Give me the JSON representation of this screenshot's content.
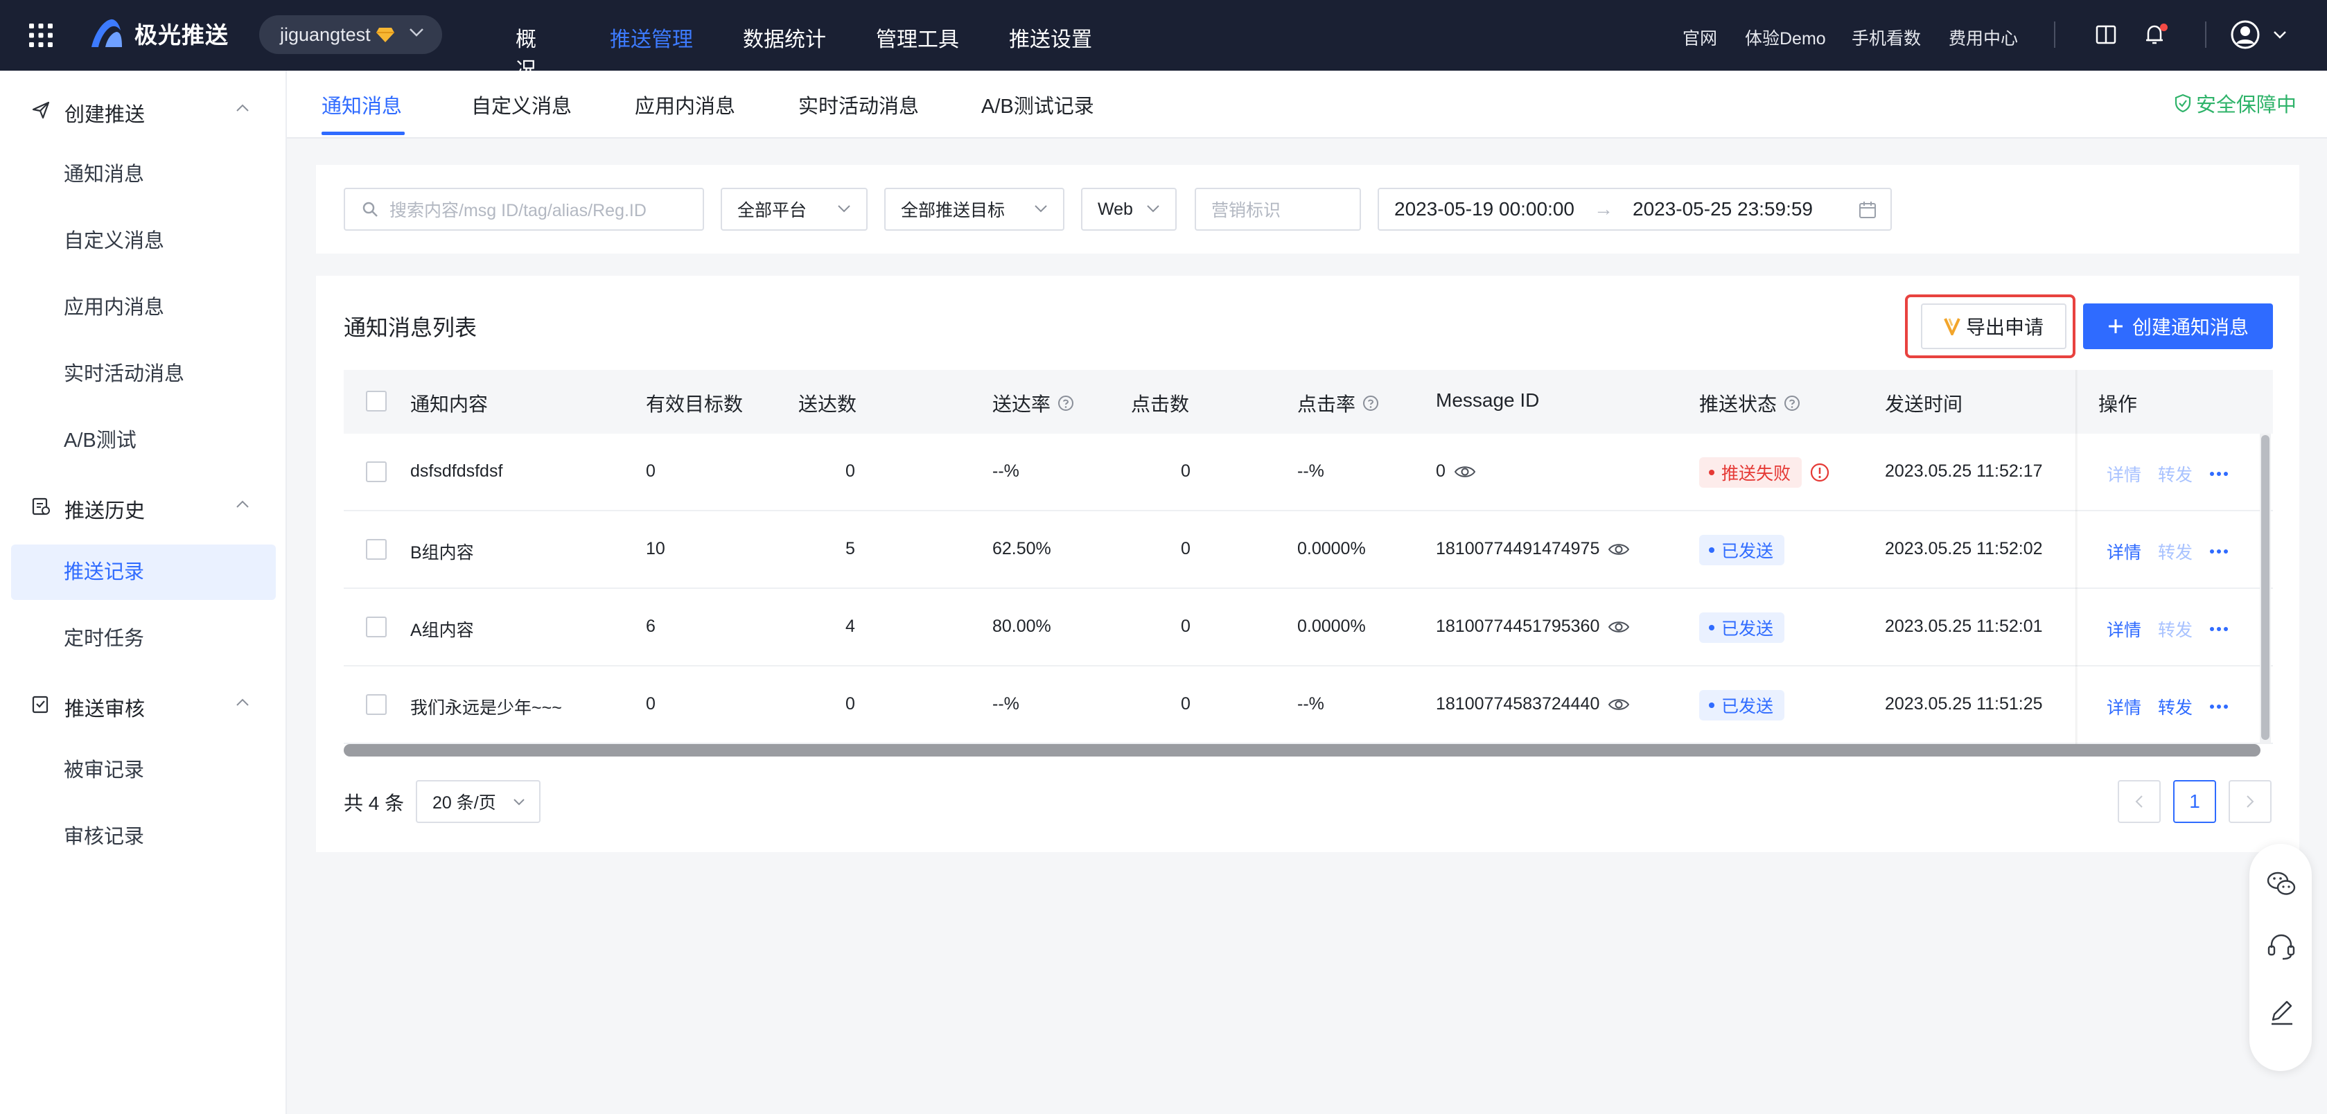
{
  "topbar": {
    "brand": "极光推送",
    "account": "jiguangtest",
    "nav": [
      "概况",
      "推送管理",
      "数据统计",
      "管理工具",
      "推送设置"
    ],
    "active_nav": "推送管理",
    "links": [
      "官网",
      "体验Demo",
      "手机看数",
      "费用中心"
    ],
    "icons": [
      "apps-grid-icon",
      "book-icon",
      "bell-icon",
      "user-avatar-icon"
    ]
  },
  "sidebar": {
    "groups": [
      {
        "label": "创建推送",
        "items": [
          "通知消息",
          "自定义消息",
          "应用内消息",
          "实时活动消息",
          "A/B测试"
        ]
      },
      {
        "label": "推送历史",
        "items": [
          "推送记录",
          "定时任务"
        ]
      },
      {
        "label": "推送审核",
        "items": [
          "被审记录",
          "审核记录"
        ]
      }
    ],
    "active_item": "推送记录"
  },
  "tabs": {
    "items": [
      "通知消息",
      "自定义消息",
      "应用内消息",
      "实时活动消息",
      "A/B测试记录"
    ],
    "active": "通知消息",
    "security": "安全保障中"
  },
  "filters": {
    "search_placeholder": "搜索内容/msg ID/tag/alias/Reg.ID",
    "platform": "全部平台",
    "target": "全部推送目标",
    "channel": "Web",
    "marketing_placeholder": "营销标识",
    "date_start": "2023-05-19 00:00:00",
    "date_arrow": "→",
    "date_end": "2023-05-25 23:59:59"
  },
  "list": {
    "title": "通知消息列表",
    "export_label": "导出申请",
    "create_label": "创建通知消息",
    "columns": [
      "通知内容",
      "有效目标数",
      "送达数",
      "送达率",
      "点击数",
      "点击率",
      "Message ID",
      "推送状态",
      "发送时间",
      "操作"
    ],
    "rows": [
      {
        "content": "dsfsdfdsfdsf",
        "targets": "0",
        "delivered": "0",
        "delivery_rate": "--%",
        "clicks": "0",
        "click_rate": "--%",
        "message_id": "0",
        "status": "推送失败",
        "status_type": "fail",
        "time": "2023.05.25 11:52:17",
        "detail": "详情",
        "forward": "转发",
        "detail_enabled": false,
        "forward_enabled": false
      },
      {
        "content": "B组内容",
        "targets": "10",
        "delivered": "5",
        "delivery_rate": "62.50%",
        "clicks": "0",
        "click_rate": "0.0000%",
        "message_id": "18100774491474975",
        "status": "已发送",
        "status_type": "ok",
        "time": "2023.05.25 11:52:02",
        "detail": "详情",
        "forward": "转发",
        "detail_enabled": true,
        "forward_enabled": false
      },
      {
        "content": "A组内容",
        "targets": "6",
        "delivered": "4",
        "delivery_rate": "80.00%",
        "clicks": "0",
        "click_rate": "0.0000%",
        "message_id": "18100774451795360",
        "status": "已发送",
        "status_type": "ok",
        "time": "2023.05.25 11:52:01",
        "detail": "详情",
        "forward": "转发",
        "detail_enabled": true,
        "forward_enabled": false
      },
      {
        "content": "我们永远是少年~~~",
        "targets": "0",
        "delivered": "0",
        "delivery_rate": "--%",
        "clicks": "0",
        "click_rate": "--%",
        "message_id": "18100774583724440",
        "status": "已发送",
        "status_type": "ok",
        "time": "2023.05.25 11:51:25",
        "detail": "详情",
        "forward": "转发",
        "detail_enabled": true,
        "forward_enabled": true
      }
    ]
  },
  "pagination": {
    "total": "共 4 条",
    "page_size": "20 条/页",
    "current_page": "1"
  },
  "colors": {
    "accent": "#2f6bff",
    "topbar": "#1a2033",
    "danger": "#e53935",
    "success": "#2fb36a"
  }
}
